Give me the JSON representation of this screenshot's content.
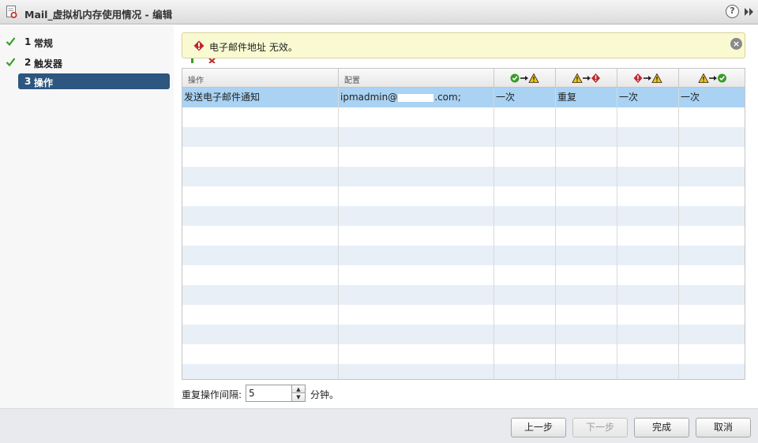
{
  "window": {
    "title": "Mail_虚拟机内存使用情况 - 编辑",
    "help_label": "?"
  },
  "sidebar": {
    "steps": [
      {
        "num": "1",
        "label": "常规",
        "status": "completed"
      },
      {
        "num": "2",
        "label": "触发器",
        "status": "completed"
      },
      {
        "num": "3",
        "label": "操作",
        "status": "active"
      }
    ]
  },
  "alert": {
    "message": "电子邮件地址 无效。",
    "close_label": "×"
  },
  "table": {
    "columns": [
      {
        "label": "操作"
      },
      {
        "label": "配置"
      },
      {
        "label": "",
        "icons": [
          "ok-icon",
          "arrow-right-icon",
          "warning-icon"
        ]
      },
      {
        "label": "",
        "icons": [
          "warning-icon",
          "arrow-right-icon",
          "error-icon"
        ]
      },
      {
        "label": "",
        "icons": [
          "error-icon",
          "arrow-right-icon",
          "warning-icon"
        ]
      },
      {
        "label": "",
        "icons": [
          "warning-icon",
          "arrow-right-icon",
          "ok-icon"
        ]
      }
    ],
    "rows": [
      {
        "action": "发送电子邮件通知",
        "config": "ipmadmin@",
        "config_tail": ".com;",
        "c1": "一次",
        "c2": "重复",
        "c3": "一次",
        "c4": "一次"
      }
    ],
    "empty_row_count": 14
  },
  "repeat_interval": {
    "label": "重复操作间隔:",
    "value": "5",
    "unit": "分钟。"
  },
  "footer": {
    "back_label": "上一步",
    "next_label": "下一步",
    "finish_label": "完成",
    "cancel_label": "取消"
  },
  "colors": {
    "accent": "#2d5680",
    "selected_row": "#a9d2f3",
    "alt_row": "#e9eff7",
    "alert_bg": "#fafad2",
    "check_green": "#3a9b2a"
  }
}
